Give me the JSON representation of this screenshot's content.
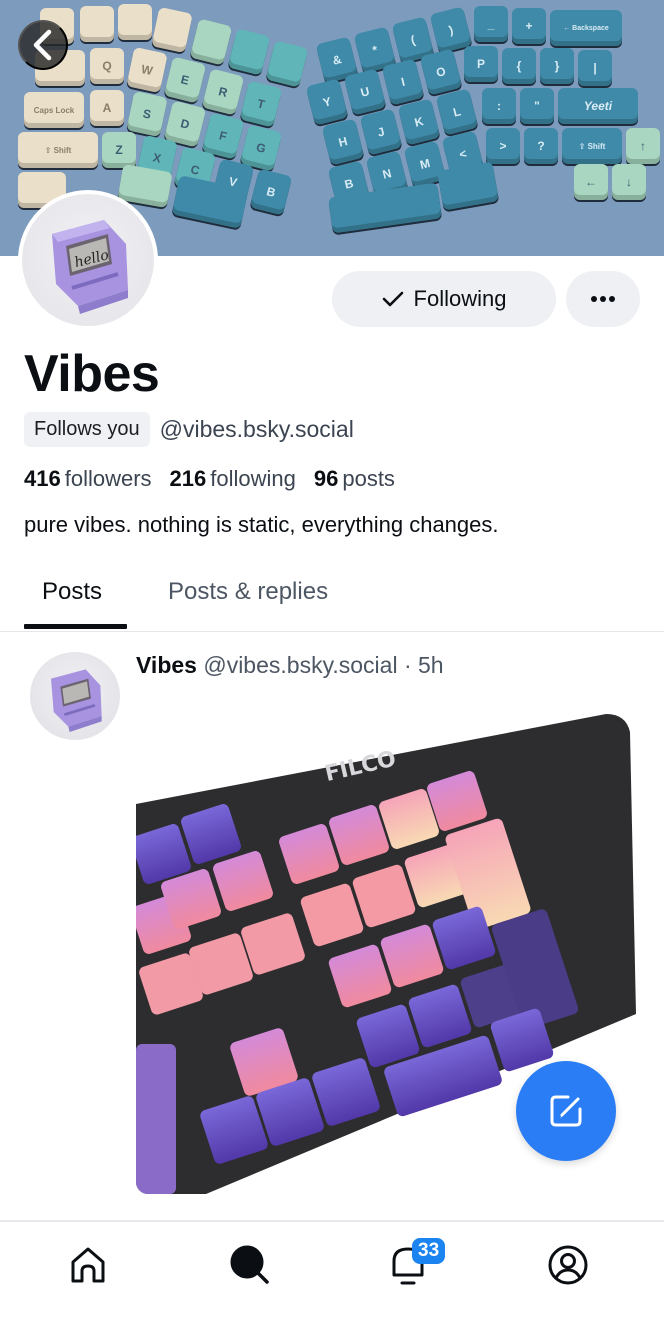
{
  "profile": {
    "display_name": "Vibes",
    "follows_you_label": "Follows you",
    "handle": "@vibes.bsky.social",
    "stats": {
      "followers_count": "416",
      "followers_label": "followers",
      "following_count": "216",
      "following_label": "following",
      "posts_count": "96",
      "posts_label": "posts"
    },
    "bio": "pure vibes. nothing is static, everything changes.",
    "banner_description": "ergonomic split keyboard with cream, mint and teal keycaps",
    "avatar_description": "purple retro computer keycap with 'hello' screen",
    "avatar_screen_text": "hello"
  },
  "actions": {
    "following_label": "Following",
    "following_icon": "check-icon",
    "more_icon": "ellipsis-icon",
    "back_icon": "chevron-left-icon"
  },
  "tabs": [
    {
      "label": "Posts",
      "active": true
    },
    {
      "label": "Posts & replies",
      "active": false
    }
  ],
  "feed": {
    "posts": [
      {
        "author": "Vibes",
        "handle": "@vibes.bsky.social",
        "separator": "·",
        "time": "5h",
        "image_description": "FILCO keyboard with purple and pink sunset keycaps",
        "image_brand_text": "FILCO"
      }
    ]
  },
  "fab": {
    "icon": "compose-icon"
  },
  "bottom_nav": {
    "items": [
      {
        "name": "home",
        "icon": "home-icon"
      },
      {
        "name": "search",
        "icon": "search-icon"
      },
      {
        "name": "notifications",
        "icon": "bell-icon",
        "badge": "33"
      },
      {
        "name": "profile",
        "icon": "user-circle-icon"
      }
    ]
  },
  "colors": {
    "accent": "#2a7df4",
    "badge": "#1b84f0",
    "button_bg": "#eef0f3",
    "text_primary": "#0b0f14",
    "text_secondary": "#4d5663"
  }
}
